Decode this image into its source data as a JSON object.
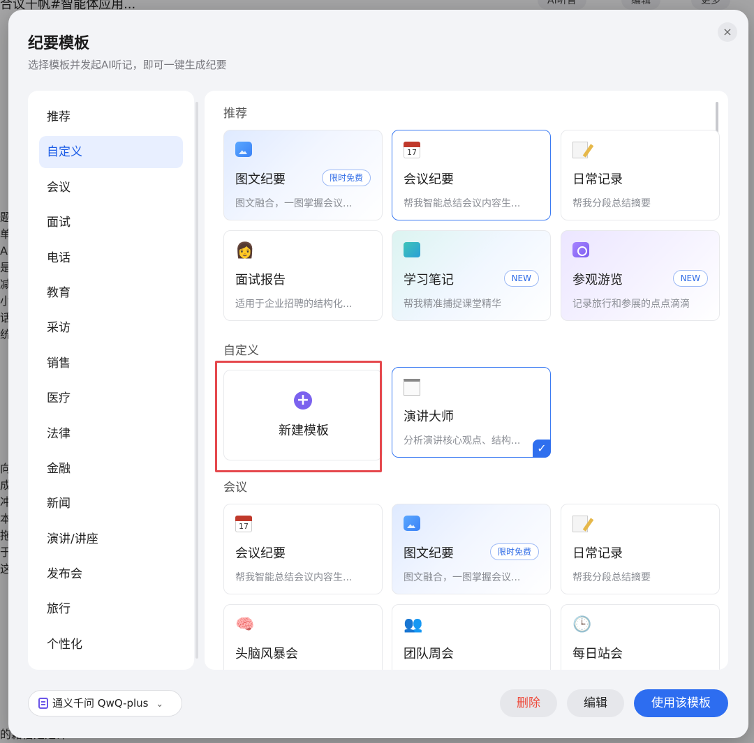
{
  "background": {
    "title_fragment": "合议千帆#智能体应用...",
    "pill_left": "AI听音",
    "pill_mid": "编辑",
    "pill_right": "更多",
    "left_chars": [
      "题",
      "单",
      "AI",
      "是",
      "减",
      "小",
      "话",
      "统",
      "",
      "",
      "",
      "",
      "",
      "",
      "",
      "向",
      "成",
      "冲",
      "本,",
      "拖",
      "于",
      "这"
    ],
    "bottom_text": "的籍信是是计"
  },
  "modal": {
    "title": "纪要模板",
    "subtitle": "选择模板并发起AI听记，即可一键生成纪要",
    "close_glyph": "×"
  },
  "sidebar": {
    "items": [
      {
        "label": "推荐"
      },
      {
        "label": "自定义",
        "active": true
      },
      {
        "label": "会议"
      },
      {
        "label": "面试"
      },
      {
        "label": "电话"
      },
      {
        "label": "教育"
      },
      {
        "label": "采访"
      },
      {
        "label": "销售"
      },
      {
        "label": "医疗"
      },
      {
        "label": "法律"
      },
      {
        "label": "金融"
      },
      {
        "label": "新闻"
      },
      {
        "label": "演讲/讲座"
      },
      {
        "label": "发布会"
      },
      {
        "label": "旅行"
      },
      {
        "label": "个性化"
      }
    ]
  },
  "sections": {
    "recommend": {
      "label": "推荐",
      "cards": [
        {
          "title": "图文纪要",
          "desc": "图文融合，一图掌握会议...",
          "badge": "限时免费",
          "icon": "image-icon"
        },
        {
          "title": "会议纪要",
          "desc": "帮我智能总结会议内容生...",
          "icon": "calendar-icon",
          "cal_day": "17"
        },
        {
          "title": "日常记录",
          "desc": "帮我分段总结摘要",
          "icon": "notepad-icon"
        },
        {
          "title": "面试报告",
          "desc": "适用于企业招聘的结构化...",
          "icon": "person-icon",
          "emoji": "👩"
        },
        {
          "title": "学习笔记",
          "desc": "帮我精准捕捉课堂精华",
          "badge": "NEW",
          "icon": "book-icon"
        },
        {
          "title": "参观游览",
          "desc": "记录旅行和参展的点点滴滴",
          "badge": "NEW",
          "icon": "camera-icon"
        }
      ]
    },
    "custom": {
      "label": "自定义",
      "new_template_label": "新建模板",
      "plus_glyph": "+",
      "cards": [
        {
          "title": "演讲大师",
          "desc": "分析演讲核心观点、结构...",
          "icon": "pad-icon",
          "check_glyph": "✓"
        }
      ]
    },
    "meeting": {
      "label": "会议",
      "cards": [
        {
          "title": "会议纪要",
          "desc": "帮我智能总结会议内容生...",
          "icon": "calendar-icon",
          "cal_day": "17"
        },
        {
          "title": "图文纪要",
          "desc": "图文融合，一图掌握会议...",
          "badge": "限时免费",
          "icon": "image-icon"
        },
        {
          "title": "日常记录",
          "desc": "帮我分段总结摘要",
          "icon": "notepad-icon"
        },
        {
          "title": "头脑风暴会",
          "icon": "brain-icon",
          "emoji": "🧠"
        },
        {
          "title": "团队周会",
          "icon": "team-icon",
          "emoji": "👥"
        },
        {
          "title": "每日站会",
          "icon": "clock-icon",
          "emoji": "🕒"
        }
      ]
    }
  },
  "footer": {
    "model_label": "通义千问 QwQ-plus",
    "model_chevron": "⌄",
    "delete_label": "删除",
    "edit_label": "编辑",
    "use_label": "使用该模板"
  }
}
